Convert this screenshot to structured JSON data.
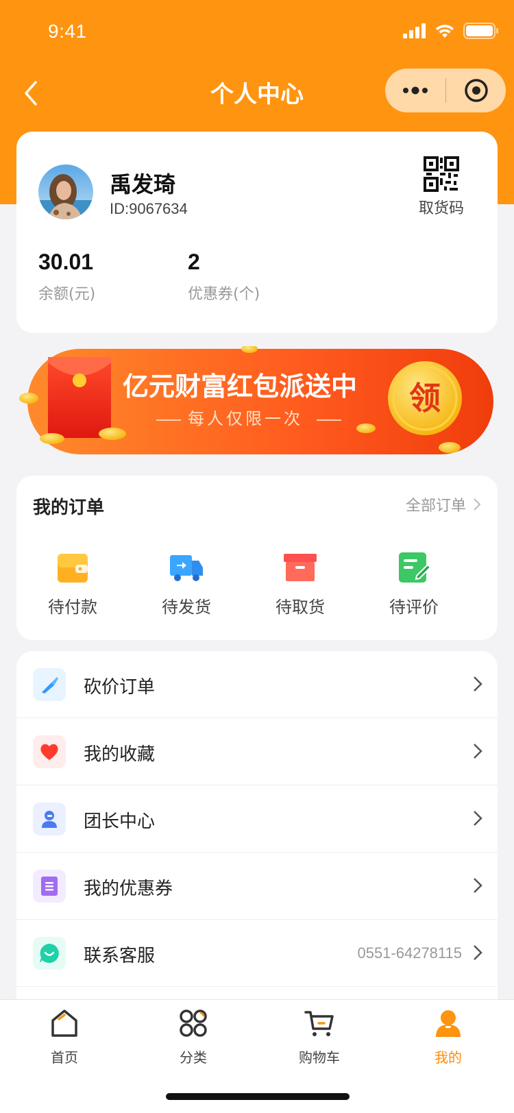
{
  "status_bar": {
    "time": "9:41"
  },
  "nav": {
    "title": "个人中心"
  },
  "profile": {
    "name": "禹发琦",
    "id_text": "ID:9067634",
    "qr_label": "取货码",
    "balance": {
      "value": "30.01",
      "label": "余额(元)"
    },
    "coupons": {
      "value": "2",
      "label": "优惠券(个)"
    }
  },
  "banner": {
    "title": "亿元财富红包派送中",
    "subtitle": "每人仅限一次",
    "button": "领"
  },
  "orders": {
    "title": "我的订单",
    "all_label": "全部订单",
    "items": [
      {
        "label": "待付款",
        "icon": "wallet-icon"
      },
      {
        "label": "待发货",
        "icon": "truck-icon"
      },
      {
        "label": "待取货",
        "icon": "box-icon"
      },
      {
        "label": "待评价",
        "icon": "review-icon"
      }
    ]
  },
  "menu": [
    {
      "label": "砍价订单",
      "icon": "knife-icon"
    },
    {
      "label": "我的收藏",
      "icon": "heart-icon"
    },
    {
      "label": "团长中心",
      "icon": "leader-icon"
    },
    {
      "label": "我的优惠券",
      "icon": "coupon-icon"
    },
    {
      "label": "联系客服",
      "icon": "chat-icon",
      "extra": "0551-64278115"
    }
  ],
  "tabbar": [
    {
      "label": "首页",
      "icon": "home-icon"
    },
    {
      "label": "分类",
      "icon": "category-icon"
    },
    {
      "label": "购物车",
      "icon": "cart-icon"
    },
    {
      "label": "我的",
      "icon": "profile-icon",
      "active": true
    }
  ],
  "colors": {
    "brand": "#ff9410",
    "active_tab": "#ff8c0a"
  }
}
